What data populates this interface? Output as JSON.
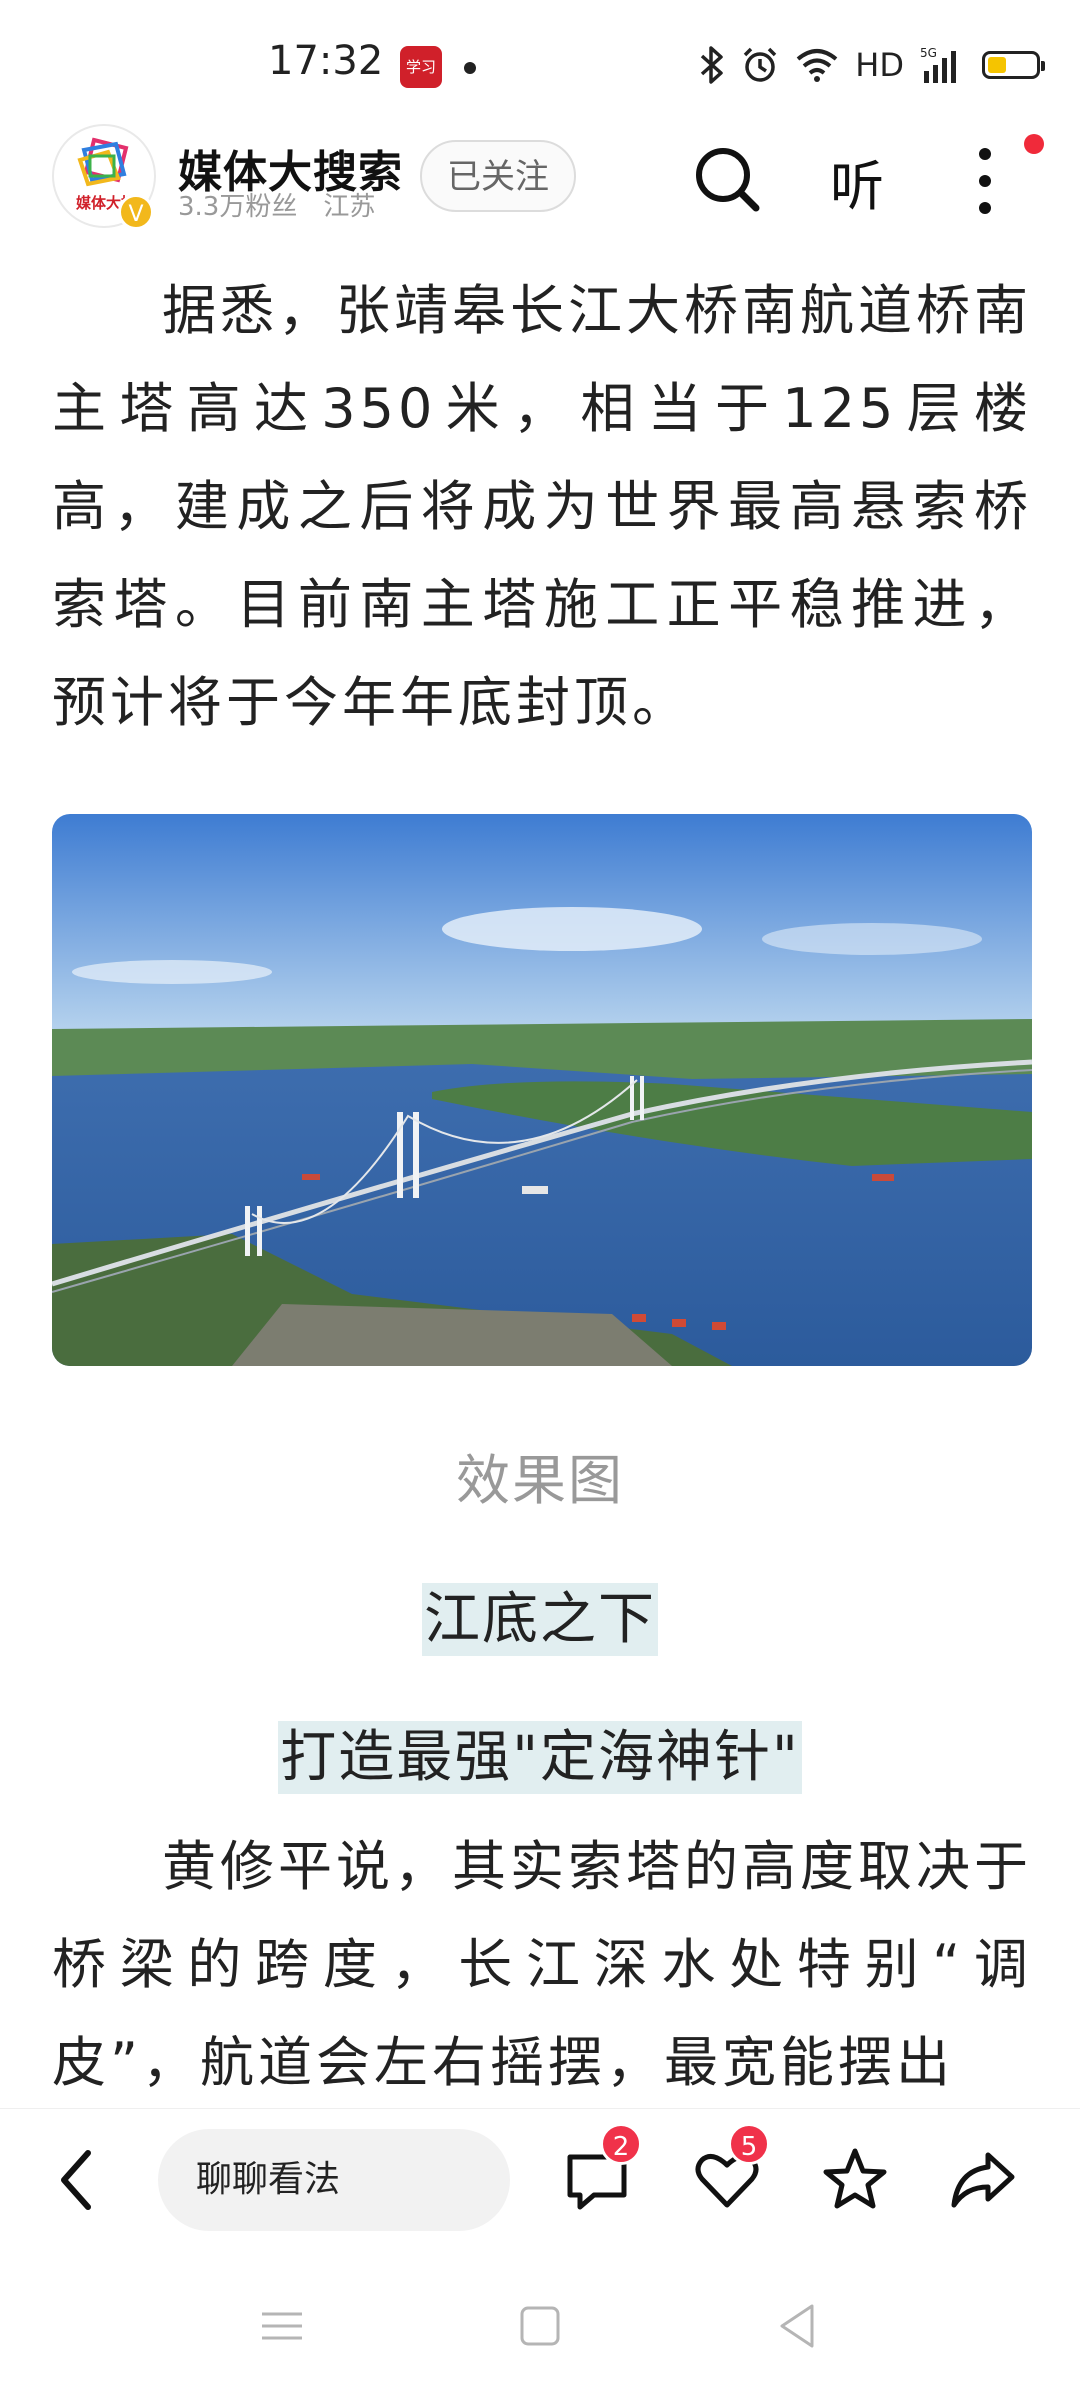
{
  "status_bar": {
    "time": "17:32",
    "app_icon_text": "学习",
    "network": "HD",
    "signal": "5G",
    "icons": [
      "bluetooth-icon",
      "alarm-icon",
      "wifi-icon",
      "signal-icon",
      "battery-icon"
    ]
  },
  "header": {
    "avatar_text": "媒体大搜",
    "verified_mark": "V",
    "account_name": "媒体大搜索",
    "followers": "3.3万粉丝",
    "location": "江苏",
    "follow_label": "已关注",
    "listen_label": "听"
  },
  "article": {
    "paragraph1": "据悉，张靖皋长江大桥南航道桥南主塔高达350米，相当于125层楼高，建成之后将成为世界最高悬索桥索塔。目前南主塔施工正平稳推进，预计将于今年年底封顶。",
    "caption": "效果图",
    "subheading1": "江底之下",
    "subheading2": "打造最强\"定海神针\"",
    "paragraph2": "黄修平说，其实索塔的高度取决于桥梁的跨度，长江深水处特别“调皮”，航道会左右摇摆，最宽能摆出"
  },
  "bottom_bar": {
    "comment_placeholder": "聊聊看法",
    "comment_count": "2",
    "like_count": "5"
  },
  "colors": {
    "accent_red": "#f0324a",
    "highlight": "#e1eef0",
    "caption_gray": "#999999"
  }
}
